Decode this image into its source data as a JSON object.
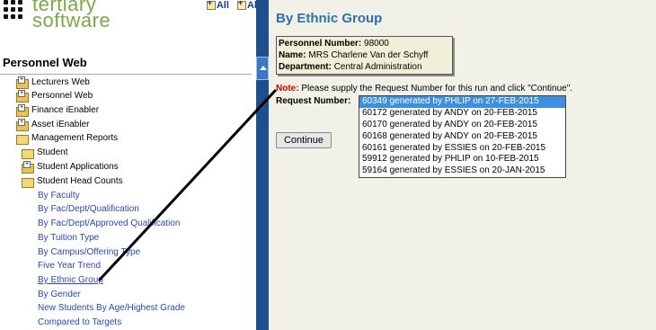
{
  "logo": {
    "line1": "tertiary",
    "line2": "software"
  },
  "expand": {
    "all1": "All",
    "all2": "All"
  },
  "sidebar": {
    "title": "Personnel Web",
    "items": [
      {
        "label": "Lecturers Web"
      },
      {
        "label": "Personnel Web"
      },
      {
        "label": "Finance iEnabler"
      },
      {
        "label": "Asset iEnabler"
      },
      {
        "label": "Management Reports"
      },
      {
        "label": "Student"
      },
      {
        "label": "Student Applications"
      },
      {
        "label": "Student Head Counts"
      },
      {
        "label": "By Faculty"
      },
      {
        "label": "By Fac/Dept/Qualification"
      },
      {
        "label": "By Fac/Dept/Approved Qualification"
      },
      {
        "label": "By Tuition Type"
      },
      {
        "label": "By Campus/Offering Type"
      },
      {
        "label": "Five Year Trend"
      },
      {
        "label": "By Ethnic Group"
      },
      {
        "label": "By Gender"
      },
      {
        "label": "New Students By Age/Highest Grade"
      },
      {
        "label": "Compared to Targets"
      }
    ]
  },
  "main": {
    "title": "By Ethnic Group",
    "personnel": {
      "number_label": "Personnel Number:",
      "number": "98000",
      "name_label": "Name:",
      "name": "MRS Charlene Van der Schyff",
      "dept_label": "Department:",
      "dept": "Central Administration"
    },
    "note_label": "Note:",
    "note_text": "Please supply the Request Number for this run and click \"Continue\".",
    "request_label": "Request Number:",
    "request_options": [
      "60349 generated by PHLIP on 27-FEB-2015",
      "60172 generated by ANDY on 20-FEB-2015",
      "60170 generated by ANDY on 20-FEB-2015",
      "60168 generated by ANDY on 20-FEB-2015",
      "60161 generated by ESSIES on 20-FEB-2015",
      "59912 generated by PHLIP on 10-FEB-2015",
      "59164 generated by ESSIES on 20-JAN-2015"
    ],
    "selected_index": 0,
    "continue_label": "Continue"
  },
  "colors": {
    "title": "#2e6fb3",
    "link": "#2a47b4",
    "note": "#cc0000",
    "selected": "#3d8fe0",
    "scrollbar": "#1f4e8c"
  }
}
